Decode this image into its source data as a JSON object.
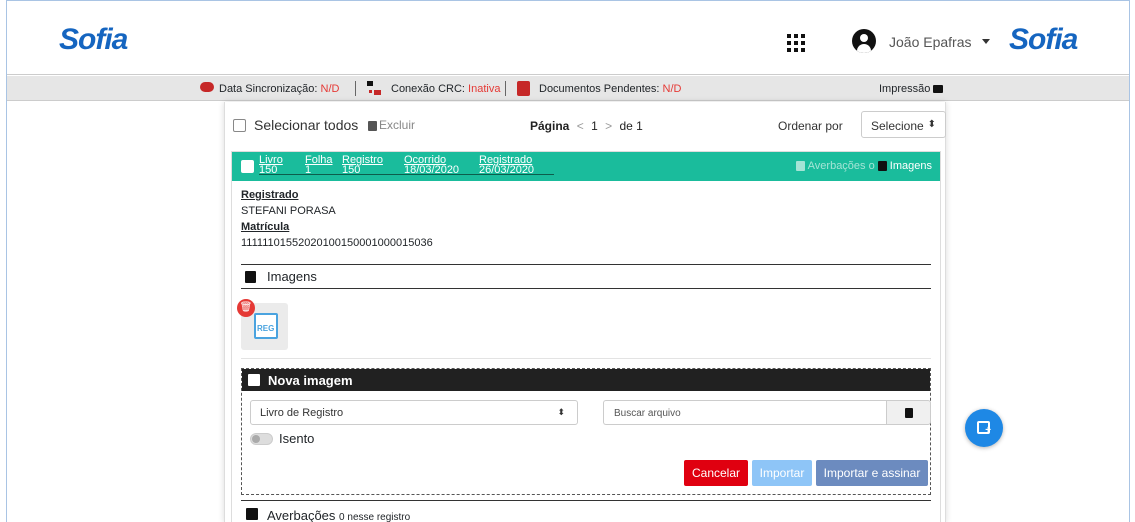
{
  "header": {
    "logo_left": "Sofia",
    "logo_right": "Sofia",
    "user_name": "João Epafras",
    "icons": {
      "apps": "grid-icon",
      "user": "account-circle-icon"
    }
  },
  "status": {
    "sync_label": "Data Sincronização:",
    "sync_value": "N/D",
    "crc_label": "Conexão CRC:",
    "crc_value": "Inativa",
    "pending_label": "Documentos Pendentes:",
    "pending_value": "N/D",
    "print_label": "Impressão",
    "accent_red": "#e53935"
  },
  "toolbar": {
    "select_all": "Selecionar todos",
    "delete": "Excluir",
    "page_label": "Página",
    "page_current": "1",
    "page_of": "de 1",
    "order_label": "Ordenar por",
    "order_value": "Selecione"
  },
  "record": {
    "header_color": "#1abc9c",
    "columns": [
      {
        "label": "Livro",
        "value": "150"
      },
      {
        "label": "Folha",
        "value": "1"
      },
      {
        "label": "Registro",
        "value": "150"
      },
      {
        "label": "Ocorrido",
        "value": "18/03/2020"
      },
      {
        "label": "Registrado",
        "value": "26/03/2020"
      }
    ],
    "tab_averbacoes": "Averbações",
    "tab_sep": "o",
    "tab_imagens": "Imagens",
    "registrado_label": "Registrado",
    "registrado_value": "STEFANI PORASA",
    "matricula_label": "Matrícula",
    "matricula_value": "111111015520201001500010000150​36"
  },
  "images_section": {
    "title": "Imagens",
    "thumb_label": "REG"
  },
  "new_image": {
    "title": "Nova imagem",
    "book_select": "Livro de Registro",
    "file_placeholder": "Buscar arquivo",
    "exempt_label": "Isento",
    "cancel": "Cancelar",
    "import": "Importar",
    "import_sign": "Importar e assinar"
  },
  "averbacoes": {
    "title": "Averbações",
    "count_text": "0 nesse registro"
  }
}
